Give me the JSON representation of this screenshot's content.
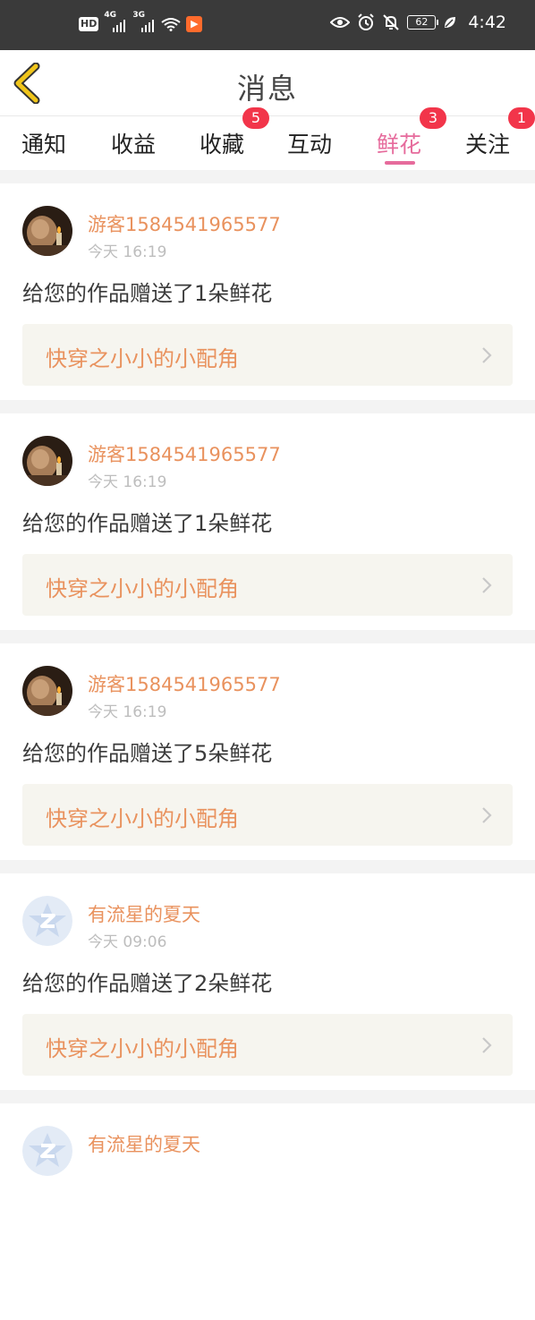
{
  "status_bar": {
    "left_badge": "HD",
    "net1": "4G",
    "net2": "3G",
    "battery": "62",
    "time": "4:42"
  },
  "nav": {
    "title": "消息"
  },
  "tabs": [
    {
      "label": "通知",
      "badge": ""
    },
    {
      "label": "收益",
      "badge": ""
    },
    {
      "label": "收藏",
      "badge": "5"
    },
    {
      "label": "互动",
      "badge": ""
    },
    {
      "label": "鲜花",
      "badge": "3",
      "active": true
    },
    {
      "label": "关注",
      "badge": "1"
    }
  ],
  "items": [
    {
      "username": "游客1584541965577",
      "time": "今天 16:19",
      "message": "给您的作品赠送了1朵鲜花",
      "work": "快穿之小小的小配角",
      "avatar": "photo"
    },
    {
      "username": "游客1584541965577",
      "time": "今天 16:19",
      "message": "给您的作品赠送了1朵鲜花",
      "work": "快穿之小小的小配角",
      "avatar": "photo"
    },
    {
      "username": "游客1584541965577",
      "time": "今天 16:19",
      "message": "给您的作品赠送了5朵鲜花",
      "work": "快穿之小小的小配角",
      "avatar": "photo"
    },
    {
      "username": "有流星的夏天",
      "time": "今天 09:06",
      "message": "给您的作品赠送了2朵鲜花",
      "work": "快穿之小小的小配角",
      "avatar": "default"
    },
    {
      "username": "有流星的夏天",
      "time": "",
      "message": "",
      "work": "",
      "avatar": "default"
    }
  ],
  "colors": {
    "accent": "#e66b9c",
    "badge": "#f2354a",
    "username": "#e9925e",
    "back_arrow": "#f0c51a"
  },
  "icons": {
    "back": "chevron-left-icon",
    "chevron": "chevron-right-icon",
    "eye": "eye-icon",
    "alarm": "alarm-icon",
    "mute": "bell-off-icon",
    "leaf": "leaf-icon",
    "wifi": "wifi-icon"
  }
}
